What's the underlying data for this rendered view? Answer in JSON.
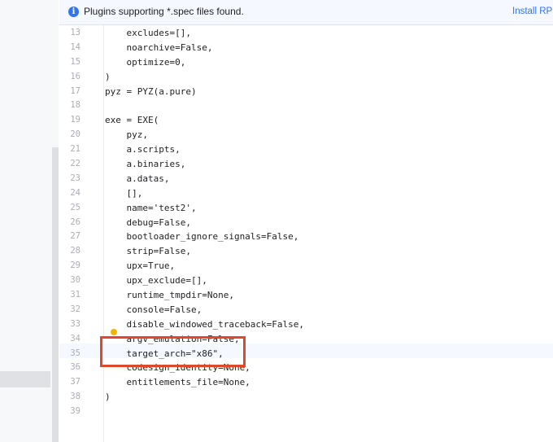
{
  "banner": {
    "icon": "info-icon",
    "icon_glyph": "i",
    "message": "Plugins supporting *.spec files found.",
    "action_label": "Install RPM"
  },
  "editor": {
    "lines": [
      {
        "num": "13",
        "text": "    excludes=[],"
      },
      {
        "num": "14",
        "text": "    noarchive=False,"
      },
      {
        "num": "15",
        "text": "    optimize=0,"
      },
      {
        "num": "16",
        "text": ")"
      },
      {
        "num": "17",
        "text": "pyz = PYZ(a.pure)"
      },
      {
        "num": "18",
        "text": ""
      },
      {
        "num": "19",
        "text": "exe = EXE("
      },
      {
        "num": "20",
        "text": "    pyz,"
      },
      {
        "num": "21",
        "text": "    a.scripts,"
      },
      {
        "num": "22",
        "text": "    a.binaries,"
      },
      {
        "num": "23",
        "text": "    a.datas,"
      },
      {
        "num": "24",
        "text": "    [],"
      },
      {
        "num": "25",
        "text": "    name='test2',"
      },
      {
        "num": "26",
        "text": "    debug=False,"
      },
      {
        "num": "27",
        "text": "    bootloader_ignore_signals=False,"
      },
      {
        "num": "28",
        "text": "    strip=False,"
      },
      {
        "num": "29",
        "text": "    upx=True,"
      },
      {
        "num": "30",
        "text": "    upx_exclude=[],"
      },
      {
        "num": "31",
        "text": "    runtime_tmpdir=None,"
      },
      {
        "num": "32",
        "text": "    console=False,"
      },
      {
        "num": "33",
        "text": "    disable_windowed_traceback=False,"
      },
      {
        "num": "34",
        "text": "    argv_emulation=False,"
      },
      {
        "num": "35",
        "text": "    target_arch=\"x86\","
      },
      {
        "num": "36",
        "text": "    codesign_identity=None,"
      },
      {
        "num": "37",
        "text": "    entitlements_file=None,"
      },
      {
        "num": "38",
        "text": ")"
      },
      {
        "num": "39",
        "text": ""
      }
    ],
    "current_line": "35",
    "intention_icon": "lightbulb-icon"
  },
  "colors": {
    "accent": "#3574f0",
    "highlight_box": "#e0472b",
    "bulb": "#f2b400"
  }
}
